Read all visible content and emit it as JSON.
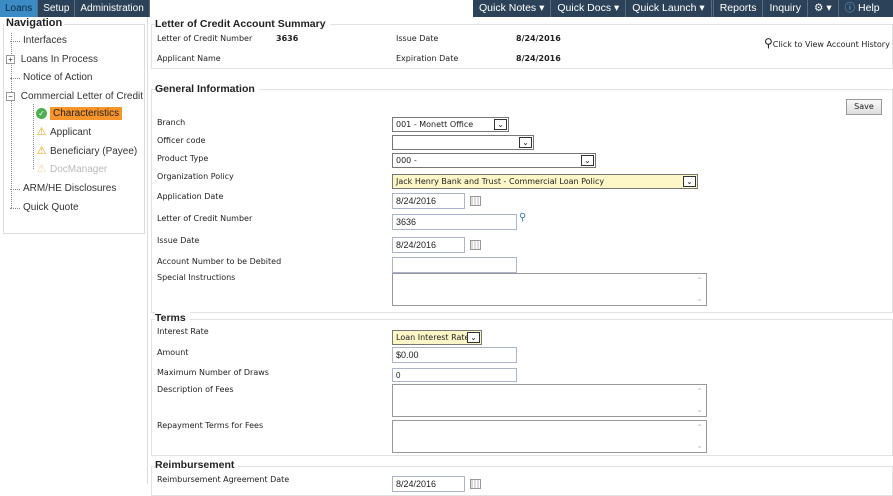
{
  "tabs": [
    "Loans",
    "Setup",
    "Administration"
  ],
  "toolbar": {
    "quick_notes": "Quick Notes",
    "quick_docs": "Quick Docs",
    "quick_launch": "Quick Launch",
    "reports": "Reports",
    "inquiry": "Inquiry",
    "help": "Help"
  },
  "nav": {
    "title": "Navigation",
    "items": [
      "Interfaces",
      "Loans In Process",
      "Notice of Action",
      "Commercial Letter of Credit",
      "Characteristics",
      "Applicant",
      "Beneficiary (Payee)",
      "DocManager",
      "ARM/HE Disclosures",
      "Quick Quote"
    ]
  },
  "summary": {
    "title": "Letter of Credit Account Summary",
    "loc_label": "Letter of Credit Number",
    "loc_value": "3636",
    "issue_label": "Issue Date",
    "issue_value": "8/24/2016",
    "applicant_label": "Applicant Name",
    "exp_label": "Expiration Date",
    "exp_value": "8/24/2016",
    "history_link": "Click to View Account History"
  },
  "general": {
    "title": "General Information",
    "save": "Save",
    "branch_label": "Branch",
    "branch_value": "001 - Monett Office",
    "officer_label": "Officer code",
    "officer_value": "",
    "product_label": "Product Type",
    "product_value": "000 -",
    "org_label": "Organization Policy",
    "org_value": "Jack Henry Bank and Trust - Commercial Loan Policy",
    "appdate_label": "Application Date",
    "appdate_value": "8/24/2016",
    "locnum_label": "Letter of Credit Number",
    "locnum_value": "3636",
    "issue_label": "Issue Date",
    "issue_value": "8/24/2016",
    "acct_label": "Account Number to be Debited",
    "acct_value": "",
    "special_label": "Special Instructions"
  },
  "terms": {
    "title": "Terms",
    "rate_label": "Interest Rate",
    "rate_value": "Loan Interest Rate",
    "amount_label": "Amount",
    "amount_value": "$0.00",
    "draws_label": "Maximum Number of Draws",
    "draws_value": "0",
    "fees_label": "Description of Fees",
    "repay_label": "Repayment Terms for Fees"
  },
  "reimb": {
    "title": "Reimbursement",
    "agree_label": "Reimbursement Agreement Date",
    "agree_value": "8/24/2016"
  }
}
